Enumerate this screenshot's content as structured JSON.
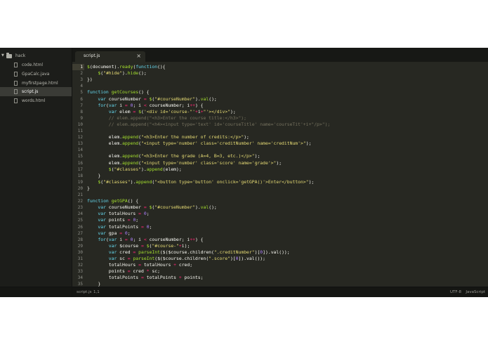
{
  "sidebar": {
    "folder": "hack",
    "files": [
      "code.html",
      "GpaCalc.java",
      "myfirstpage.html",
      "script.js",
      "words.html"
    ],
    "selected": "script.js"
  },
  "tab": {
    "label": "script.js",
    "close": "×"
  },
  "status": {
    "file": "script.js",
    "position": "1,1",
    "encoding": "UTF-8",
    "syntax": "JavaScript"
  },
  "colors": {
    "editor_bg": "#272822",
    "sidebar_bg": "#1c1d1a",
    "keyword": "#66d9ef",
    "function": "#a6e22e",
    "string": "#e6db74",
    "number": "#ae81ff",
    "comment": "#75715e",
    "operator": "#f92672"
  },
  "icons": [
    "folder-icon",
    "file-icon",
    "close-icon",
    "chevron-down-icon"
  ],
  "active_line": 1,
  "code": [
    [
      [
        "f",
        "$"
      ],
      [
        "t",
        "(document)."
      ],
      [
        "f",
        "ready"
      ],
      [
        "t",
        "("
      ],
      [
        "k",
        "function"
      ],
      [
        "t",
        "(){"
      ]
    ],
    [
      [
        "t",
        "    "
      ],
      [
        "f",
        "$"
      ],
      [
        "t",
        "("
      ],
      [
        "s",
        "\"#hide\""
      ],
      [
        "t",
        ")."
      ],
      [
        "f",
        "hide"
      ],
      [
        "t",
        "();"
      ]
    ],
    [
      [
        "t",
        "})"
      ]
    ],
    [],
    [
      [
        "k",
        "function"
      ],
      [
        "t",
        " "
      ],
      [
        "f",
        "getCourses"
      ],
      [
        "t",
        "() {"
      ]
    ],
    [
      [
        "t",
        "    "
      ],
      [
        "k",
        "var"
      ],
      [
        "t",
        " courseNumber "
      ],
      [
        "p",
        "="
      ],
      [
        "t",
        " "
      ],
      [
        "f",
        "$"
      ],
      [
        "t",
        "("
      ],
      [
        "s",
        "\"#courseNumber\""
      ],
      [
        "t",
        ")."
      ],
      [
        "f",
        "val"
      ],
      [
        "t",
        "();"
      ]
    ],
    [
      [
        "t",
        "    "
      ],
      [
        "k",
        "for"
      ],
      [
        "t",
        "("
      ],
      [
        "k",
        "var"
      ],
      [
        "t",
        " i "
      ],
      [
        "p",
        "="
      ],
      [
        "t",
        " "
      ],
      [
        "n",
        "0"
      ],
      [
        "t",
        "; i "
      ],
      [
        "p",
        "<"
      ],
      [
        "t",
        " courseNumber; i"
      ],
      [
        "p",
        "++"
      ],
      [
        "t",
        ") {"
      ]
    ],
    [
      [
        "t",
        "        "
      ],
      [
        "k",
        "var"
      ],
      [
        "t",
        " elem "
      ],
      [
        "p",
        "="
      ],
      [
        "t",
        " "
      ],
      [
        "f",
        "$"
      ],
      [
        "t",
        "("
      ],
      [
        "s",
        "'<div id='course-\"'"
      ],
      [
        "p",
        "+"
      ],
      [
        "t",
        "i"
      ],
      [
        "p",
        "+"
      ],
      [
        "s",
        "\"'></div>\""
      ],
      [
        "t",
        ");"
      ]
    ],
    [
      [
        "t",
        "        "
      ],
      [
        "c",
        "// elem.append(\"<h3>Enter the course title:</h3>\");"
      ]
    ],
    [
      [
        "t",
        "        "
      ],
      [
        "c",
        "// elem.append(\"<h4><input type='text' id='courseTitle' name='courseTit'+i+\"/p>\");"
      ]
    ],
    [],
    [
      [
        "t",
        "        elem."
      ],
      [
        "f",
        "append"
      ],
      [
        "t",
        "("
      ],
      [
        "s",
        "\"<h3>Enter the number of credits:</p>\""
      ],
      [
        "t",
        ");"
      ]
    ],
    [
      [
        "t",
        "        elem."
      ],
      [
        "f",
        "append"
      ],
      [
        "t",
        "("
      ],
      [
        "s",
        "\"<input type='number' class='creditNumber' name='creditNum'>\""
      ],
      [
        "t",
        ");"
      ]
    ],
    [],
    [
      [
        "t",
        "        elem."
      ],
      [
        "f",
        "append"
      ],
      [
        "t",
        "("
      ],
      [
        "s",
        "\"<h3>Enter the grade (A=4, B=3, etc.)</p>\""
      ],
      [
        "t",
        ");"
      ]
    ],
    [
      [
        "t",
        "        elem."
      ],
      [
        "f",
        "append"
      ],
      [
        "t",
        "("
      ],
      [
        "s",
        "\"<input type='number' class='score' name='grade'>\""
      ],
      [
        "t",
        ");"
      ]
    ],
    [
      [
        "t",
        "        "
      ],
      [
        "f",
        "$"
      ],
      [
        "t",
        "("
      ],
      [
        "s",
        "\"#classes\""
      ],
      [
        "t",
        ")."
      ],
      [
        "f",
        "append"
      ],
      [
        "t",
        "(elem);"
      ]
    ],
    [
      [
        "t",
        "    }"
      ]
    ],
    [
      [
        "t",
        "    "
      ],
      [
        "f",
        "$"
      ],
      [
        "t",
        "("
      ],
      [
        "s",
        "\"#classes\""
      ],
      [
        "t",
        ")."
      ],
      [
        "f",
        "append"
      ],
      [
        "t",
        "("
      ],
      [
        "s",
        "\"<button type='button' onclick='getGPA()'>Enter</button>\""
      ],
      [
        "t",
        ");"
      ]
    ],
    [
      [
        "t",
        "}"
      ]
    ],
    [],
    [
      [
        "k",
        "function"
      ],
      [
        "t",
        " "
      ],
      [
        "f",
        "getGPA"
      ],
      [
        "t",
        "() {"
      ]
    ],
    [
      [
        "t",
        "    "
      ],
      [
        "k",
        "var"
      ],
      [
        "t",
        " courseNumber "
      ],
      [
        "p",
        "="
      ],
      [
        "t",
        " "
      ],
      [
        "f",
        "$"
      ],
      [
        "t",
        "("
      ],
      [
        "s",
        "\"#courseNumber\""
      ],
      [
        "t",
        ")."
      ],
      [
        "f",
        "val"
      ],
      [
        "t",
        "();"
      ]
    ],
    [
      [
        "t",
        "    "
      ],
      [
        "k",
        "var"
      ],
      [
        "t",
        " totalHours "
      ],
      [
        "p",
        "="
      ],
      [
        "t",
        " "
      ],
      [
        "n",
        "0"
      ],
      [
        "t",
        ";"
      ]
    ],
    [
      [
        "t",
        "    "
      ],
      [
        "k",
        "var"
      ],
      [
        "t",
        " points "
      ],
      [
        "p",
        "="
      ],
      [
        "t",
        " "
      ],
      [
        "n",
        "0"
      ],
      [
        "t",
        ";"
      ]
    ],
    [
      [
        "t",
        "    "
      ],
      [
        "k",
        "var"
      ],
      [
        "t",
        " totalPoints "
      ],
      [
        "p",
        "="
      ],
      [
        "t",
        " "
      ],
      [
        "n",
        "0"
      ],
      [
        "t",
        ";"
      ]
    ],
    [
      [
        "t",
        "    "
      ],
      [
        "k",
        "var"
      ],
      [
        "t",
        " gpa "
      ],
      [
        "p",
        "="
      ],
      [
        "t",
        " "
      ],
      [
        "n",
        "0"
      ],
      [
        "t",
        ";"
      ]
    ],
    [
      [
        "t",
        "    "
      ],
      [
        "k",
        "for"
      ],
      [
        "t",
        "("
      ],
      [
        "k",
        "var"
      ],
      [
        "t",
        " i "
      ],
      [
        "p",
        "="
      ],
      [
        "t",
        " "
      ],
      [
        "n",
        "0"
      ],
      [
        "t",
        "; i "
      ],
      [
        "p",
        "<"
      ],
      [
        "t",
        " courseNumber; i"
      ],
      [
        "p",
        "++"
      ],
      [
        "t",
        ") {"
      ]
    ],
    [
      [
        "t",
        "        "
      ],
      [
        "k",
        "var"
      ],
      [
        "t",
        " $course "
      ],
      [
        "p",
        "="
      ],
      [
        "t",
        " "
      ],
      [
        "f",
        "$"
      ],
      [
        "t",
        "("
      ],
      [
        "s",
        "\"#course-\""
      ],
      [
        "p",
        "+"
      ],
      [
        "t",
        "i);"
      ]
    ],
    [
      [
        "t",
        "        "
      ],
      [
        "k",
        "var"
      ],
      [
        "t",
        " cred "
      ],
      [
        "p",
        "="
      ],
      [
        "t",
        " "
      ],
      [
        "f",
        "parseInt"
      ],
      [
        "t",
        "($($course.children("
      ],
      [
        "s",
        "\".creditNumber\""
      ],
      [
        "t",
        ")["
      ],
      [
        "n",
        "0"
      ],
      [
        "t",
        "]).val());"
      ]
    ],
    [
      [
        "t",
        "        "
      ],
      [
        "k",
        "var"
      ],
      [
        "t",
        " sc "
      ],
      [
        "p",
        "="
      ],
      [
        "t",
        " "
      ],
      [
        "f",
        "parseInt"
      ],
      [
        "t",
        "($($course.children("
      ],
      [
        "s",
        "\".score\""
      ],
      [
        "t",
        ")["
      ],
      [
        "n",
        "0"
      ],
      [
        "t",
        "]).val());"
      ]
    ],
    [
      [
        "t",
        "        totalHours "
      ],
      [
        "p",
        "="
      ],
      [
        "t",
        " totalHours "
      ],
      [
        "p",
        "+"
      ],
      [
        "t",
        " cred;"
      ]
    ],
    [
      [
        "t",
        "        points "
      ],
      [
        "p",
        "="
      ],
      [
        "t",
        " cred "
      ],
      [
        "p",
        "*"
      ],
      [
        "t",
        " sc;"
      ]
    ],
    [
      [
        "t",
        "        totalPoints "
      ],
      [
        "p",
        "="
      ],
      [
        "t",
        " totalPoints "
      ],
      [
        "p",
        "+"
      ],
      [
        "t",
        " points;"
      ]
    ],
    [
      [
        "t",
        "    }"
      ]
    ]
  ]
}
